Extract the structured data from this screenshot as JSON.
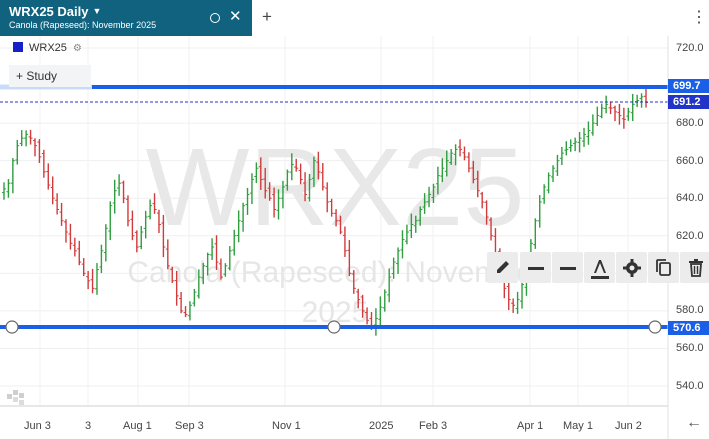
{
  "tab": {
    "title": "WRX25 Daily",
    "subtitle": "Canola (Rapeseed): November 2025"
  },
  "legend": {
    "symbol": "WRX25",
    "swatch_color": "#1421c8"
  },
  "study_button": {
    "label": "Study"
  },
  "watermark": {
    "symbol": "WRX25",
    "name": "Canola (Rapeseed): November 2025"
  },
  "price_axis": {
    "labels": [
      "720.0",
      "680.0",
      "660.0",
      "640.0",
      "620.0",
      "580.0",
      "560.0",
      "540.0"
    ]
  },
  "time_axis": {
    "labels": [
      "Jun 3",
      "3",
      "Aug 1",
      "Sep 3",
      "Nov 1",
      "2025",
      "Feb 3",
      "Apr 1",
      "May 1",
      "Jun 2"
    ]
  },
  "price_tags": {
    "upper_line": "699.7",
    "last_price": "691.2",
    "lower_line": "570.6"
  },
  "colors": {
    "tab_bg": "#10627f",
    "line_blue": "#1a5fe6",
    "candle_up": "#2e9e3e",
    "candle_down": "#d23b3b",
    "last_price": "#2233c8"
  },
  "drawing_toolbar": {
    "tools": [
      "pencil-icon",
      "line-style-icon",
      "line-width-icon",
      "text-color-icon",
      "gear-icon",
      "copy-icon",
      "trash-icon"
    ]
  },
  "chart_data": {
    "type": "ohlc",
    "ylim": [
      530,
      728
    ],
    "ytick_values": [
      720,
      680,
      660,
      640,
      620,
      580,
      560,
      540
    ],
    "xtick_positions_are_layout": true,
    "closes_sampled": [
      645,
      648,
      660,
      668,
      672,
      674,
      672,
      668,
      662,
      654,
      647,
      640,
      634,
      628,
      622,
      616,
      612,
      606,
      600,
      596,
      592,
      602,
      612,
      624,
      636,
      644,
      648,
      640,
      628,
      620,
      614,
      622,
      630,
      636,
      634,
      626,
      614,
      604,
      596,
      588,
      580,
      578,
      583,
      590,
      598,
      604,
      610,
      614,
      606,
      598,
      604,
      612,
      620,
      628,
      636,
      642,
      650,
      656,
      650,
      644,
      640,
      634,
      640,
      646,
      654,
      658,
      656,
      650,
      642,
      650,
      660,
      654,
      646,
      638,
      632,
      628,
      622,
      612,
      600,
      592,
      586,
      580,
      575,
      572,
      576,
      582,
      590,
      598,
      606,
      612,
      618,
      622,
      626,
      628,
      634,
      638,
      642,
      646,
      652,
      656,
      660,
      664,
      666,
      666,
      662,
      656,
      650,
      644,
      638,
      630,
      620,
      610,
      600,
      592,
      586,
      583,
      586,
      594,
      604,
      616,
      628,
      638,
      646,
      652,
      656,
      660,
      664,
      666,
      668,
      670,
      672,
      674,
      676,
      680,
      684,
      688,
      690,
      688,
      686,
      684,
      682,
      686,
      690,
      692,
      694,
      691
    ],
    "horizontal_lines": [
      {
        "value": 699.7,
        "style": "solid"
      },
      {
        "value": 691.2,
        "style": "dashed",
        "label": "last"
      },
      {
        "value": 570.6,
        "style": "solid"
      }
    ]
  }
}
